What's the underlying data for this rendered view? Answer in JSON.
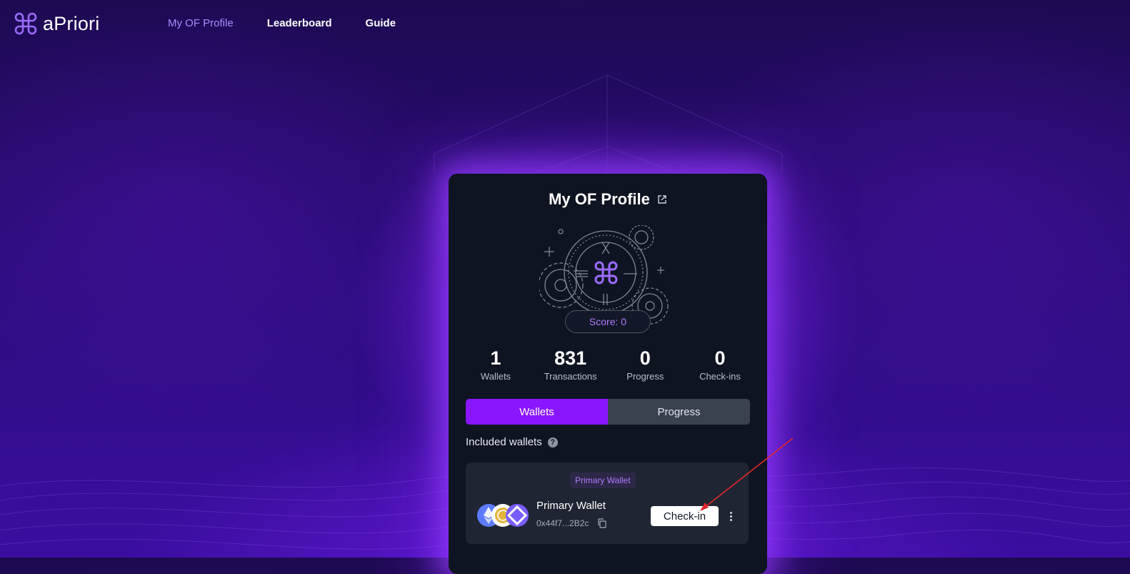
{
  "header": {
    "brand": "aPriori",
    "nav": [
      {
        "label": "My OF Profile",
        "active": true
      },
      {
        "label": "Leaderboard",
        "active": false
      },
      {
        "label": "Guide",
        "active": false
      }
    ]
  },
  "profile": {
    "title": "My OF Profile",
    "score_label": "Score: 0",
    "stats": [
      {
        "value": "1",
        "label": "Wallets"
      },
      {
        "value": "831",
        "label": "Transactions"
      },
      {
        "value": "0",
        "label": "Progress"
      },
      {
        "value": "0",
        "label": "Check-ins"
      }
    ],
    "tabs": [
      {
        "label": "Wallets",
        "active": true
      },
      {
        "label": "Progress",
        "active": false
      }
    ],
    "included_wallets_label": "Included wallets",
    "wallet": {
      "tag": "Primary Wallet",
      "name": "Primary Wallet",
      "address": "0x44f7...2B2c",
      "checkin_label": "Check-in",
      "icons": [
        "ethereum-icon",
        "coin-icon",
        "monad-icon"
      ]
    }
  },
  "colors": {
    "accent": "#8a16ff",
    "accent_text": "#b07aff",
    "card_bg": "#0f1422",
    "wallet_card_bg": "#1f2533",
    "annotation_arrow": "#e0282c"
  }
}
